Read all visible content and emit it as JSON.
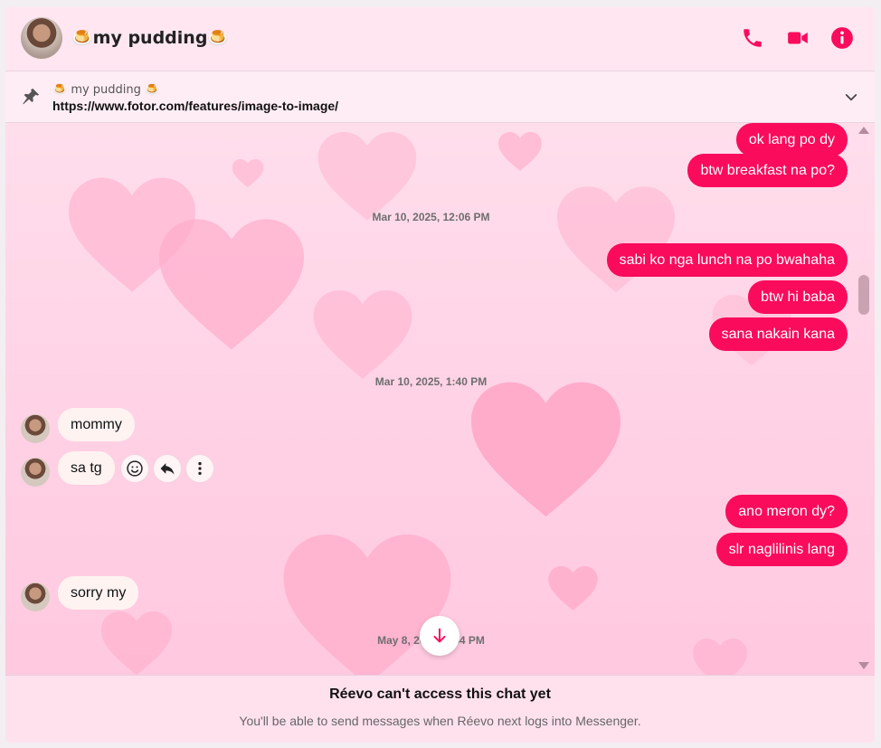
{
  "header": {
    "title": "🍮my pudding🍮",
    "icons": [
      "phone-icon",
      "video-icon",
      "info-icon"
    ],
    "accent": "#fa0b5c"
  },
  "pinned": {
    "name": "🍮 my pudding 🍮",
    "url": "https://www.fotor.com/features/image-to-image/"
  },
  "messages": {
    "m1": "ok lang po dy",
    "m2": "btw breakfast na po?",
    "ts1": "Mar 10, 2025, 12:06 PM",
    "m3": "sabi ko nga lunch na po bwahaha",
    "m4": "btw hi baba",
    "m5": "sana nakain kana",
    "ts2": "Mar 10, 2025, 1:40 PM",
    "m6": "mommy",
    "m7": "sa tg",
    "m8": "ano meron dy?",
    "m9": "slr naglilinis lang",
    "m10": "sorry my",
    "ts3": "May 8, 2025, 7:54 PM"
  },
  "footer": {
    "title": "Réevo can't access this chat yet",
    "subtitle": "You'll be able to send messages when Réevo next logs into Messenger."
  },
  "colors": {
    "outgoing_bubble": "#fa0b5c",
    "incoming_bubble": "#fff3f2",
    "background": "#ffd4e6"
  }
}
